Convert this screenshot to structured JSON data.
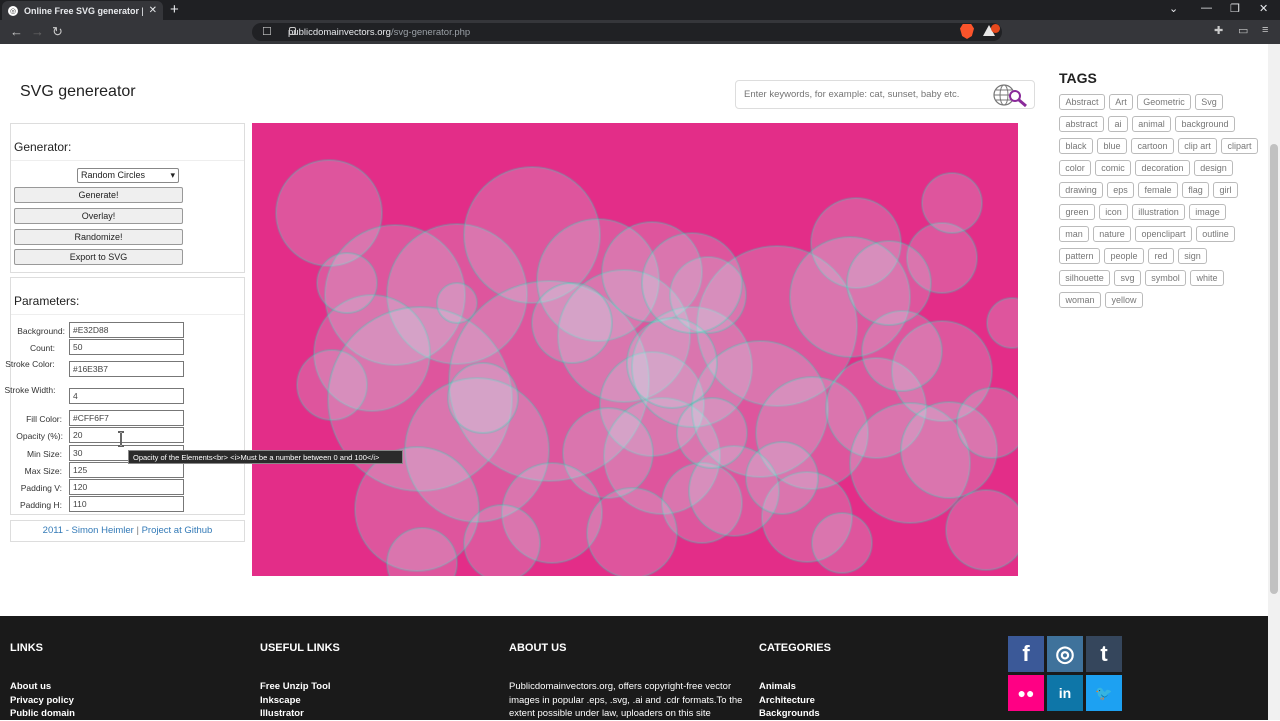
{
  "browser": {
    "tab_title": "Online Free SVG generator | Publi",
    "url_host": "publicdomainvectors.org",
    "url_path": "/svg-generator.php"
  },
  "page": {
    "title": "SVG genereator",
    "search_placeholder": "Enter keywords, for example: cat, sunset, baby etc."
  },
  "generator": {
    "heading": "Generator:",
    "type_selected": "Random Circles",
    "buttons": [
      "Generate!",
      "Overlay!",
      "Randomize!",
      "Export to SVG"
    ]
  },
  "parameters": {
    "heading": "Parameters:",
    "fields": [
      {
        "label": "Background:",
        "value": "#E32D88"
      },
      {
        "label": "Count:",
        "value": "50"
      },
      {
        "label": "Stroke Color:",
        "value": "#16E3B7"
      },
      {
        "label": "Stroke Width:",
        "value": "4"
      },
      {
        "label": "Fill Color:",
        "value": "#CFF6F7"
      },
      {
        "label": "Opacity (%):",
        "value": "20"
      },
      {
        "label": "Min Size:",
        "value": "30"
      },
      {
        "label": "Max Size:",
        "value": "125"
      },
      {
        "label": "Padding V:",
        "value": "120"
      },
      {
        "label": "Padding H:",
        "value": "110"
      }
    ]
  },
  "tooltip": "Opacity of the Elements<br> <i>Must be a number between 0 and 100</i>",
  "credits": {
    "author": "2011 - Simon Heimler",
    "separator": "|",
    "project": "Project at Github"
  },
  "canvas": {
    "background": "#E32D88",
    "stroke": "#16E3B7",
    "fill": "#CFF6F7"
  },
  "tags": {
    "title": "TAGS",
    "items": [
      "Abstract",
      "Art",
      "Geometric",
      "Svg",
      "abstract",
      "ai",
      "animal",
      "background",
      "black",
      "blue",
      "cartoon",
      "clip art",
      "clipart",
      "color",
      "comic",
      "decoration",
      "design",
      "drawing",
      "eps",
      "female",
      "flag",
      "girl",
      "green",
      "icon",
      "illustration",
      "image",
      "man",
      "nature",
      "openclipart",
      "outline",
      "pattern",
      "people",
      "red",
      "sign",
      "silhouette",
      "svg",
      "symbol",
      "white",
      "woman",
      "yellow"
    ]
  },
  "footer": {
    "links": {
      "title": "LINKS",
      "items": [
        "About us",
        "Privacy policy",
        "Public domain"
      ]
    },
    "useful": {
      "title": "USEFUL LINKS",
      "items": [
        "Free Unzip Tool",
        "Inkscape",
        "Illustrator"
      ]
    },
    "about": {
      "title": "ABOUT US",
      "text": "Publicdomainvectors.org, offers copyright-free vector images in popular .eps, .svg, .ai and .cdr formats.To the extent possible under law, uploaders on this site"
    },
    "categories": {
      "title": "CATEGORIES",
      "items": [
        "Animals",
        "Architecture",
        "Backgrounds"
      ]
    },
    "social": [
      {
        "icon": "facebook-icon",
        "glyph": "f",
        "color": "#3b5998"
      },
      {
        "icon": "instagram-icon",
        "glyph": "◎",
        "color": "#3f729b"
      },
      {
        "icon": "tumblr-icon",
        "glyph": "t",
        "color": "#35465c"
      },
      {
        "icon": "flickr-icon",
        "glyph": "●●",
        "color": "#ff0084"
      },
      {
        "icon": "linkedin-icon",
        "glyph": "in",
        "color": "#0e76a8"
      },
      {
        "icon": "twitter-icon",
        "glyph": "🐦",
        "color": "#1da1f2"
      }
    ]
  }
}
